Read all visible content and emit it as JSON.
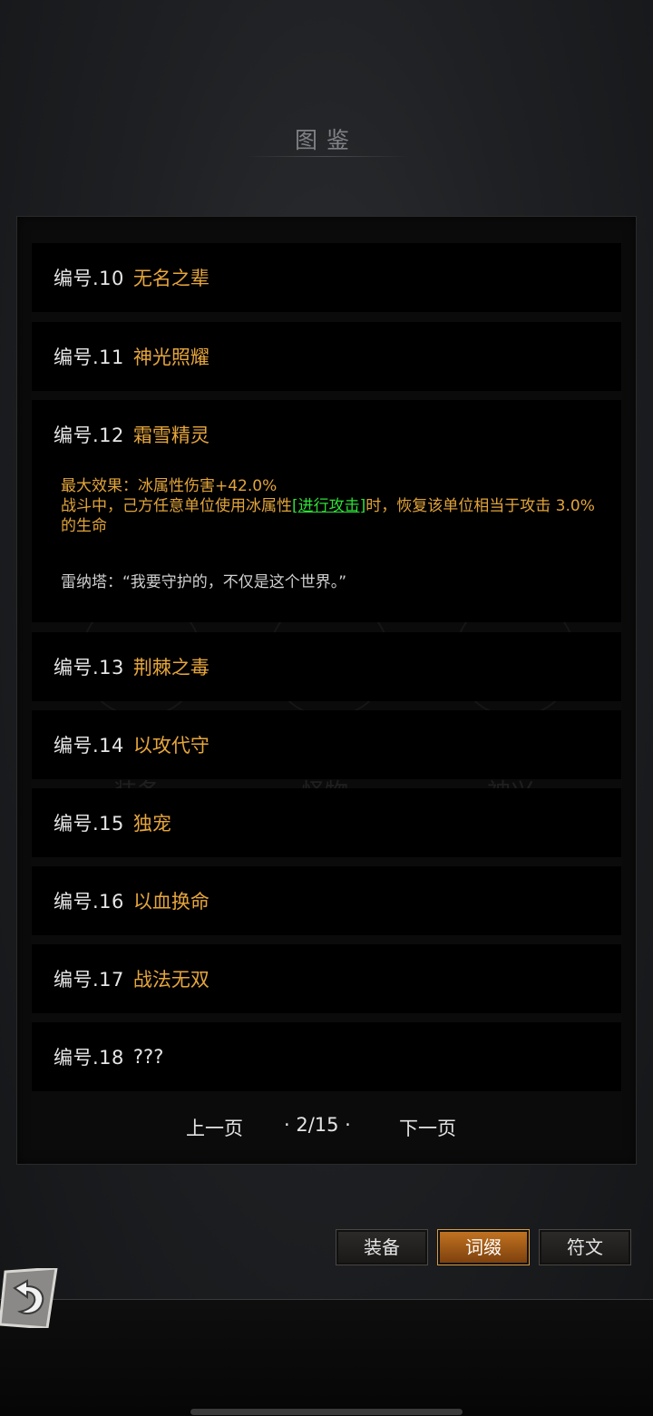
{
  "header": {
    "title": "图鉴"
  },
  "entries": [
    {
      "num": "编号.10",
      "name": "无名之辈"
    },
    {
      "num": "编号.11",
      "name": "神光照耀"
    },
    {
      "num": "编号.12",
      "name": "霜雪精灵"
    },
    {
      "num": "编号.13",
      "name": "荆棘之毒"
    },
    {
      "num": "编号.14",
      "name": "以攻代守"
    },
    {
      "num": "编号.15",
      "name": "独宠"
    },
    {
      "num": "编号.16",
      "name": "以血换命"
    },
    {
      "num": "编号.17",
      "name": "战法无双"
    },
    {
      "num": "编号.18",
      "name": "???"
    }
  ],
  "expanded": {
    "max_effect": "最大效果：冰属性伤害+42.0%",
    "desc_before": "战斗中，己方任意单位使用冰属性",
    "desc_link": "[进行攻击]",
    "desc_after": "时，恢复该单位相当于攻击 3.0% 的生命",
    "quote": "雷纳塔：“我要守护的，不仅是这个世界。”"
  },
  "background_labels": [
    "装备",
    "怪物",
    "神兴"
  ],
  "pager": {
    "prev": "上一页",
    "page": "· 2/15 ·",
    "next": "下一页"
  },
  "tabs": [
    {
      "label": "装备",
      "active": false
    },
    {
      "label": "词缀",
      "active": true
    },
    {
      "label": "符文",
      "active": false
    }
  ],
  "colors": {
    "accent": "#e6a63c",
    "highlight": "#2ddf36",
    "tab_active": "#c47522"
  },
  "icons": {
    "back": "back-arrow-icon"
  }
}
